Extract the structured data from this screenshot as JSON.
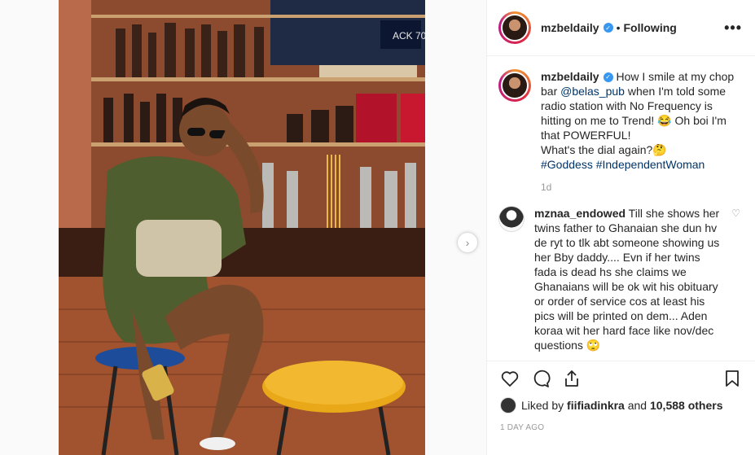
{
  "post": {
    "username": "mzbeldaily",
    "separator": "•",
    "follow_status": "Following",
    "more_label": "•••"
  },
  "caption": {
    "username": "mzbeldaily",
    "text_before_mention": "How I smile at my chop bar",
    "mention": "@belas_pub",
    "text_after_mention": "when I'm told some radio station with No Frequency is hitting on me to Trend! 😂 Oh boi I'm that POWERFUL!",
    "line2": "What's the dial again?🤔",
    "hashtag1": "#Goddess",
    "hashtag2": "#IndependentWoman",
    "time_ago": "1d"
  },
  "comment": {
    "username": "mznaa_endowed",
    "text": "Till she shows her twins father to Ghanaian she dun hv de ryt to tlk abt someone showing us her Bby daddy.... Evn if her twins fada is dead hs she claims we Ghanaians will be ok wit his obituary or order of service cos at least his pics will be printed on dem... Aden koraa wit her hard face like nov/dec questions 🙄"
  },
  "likes": {
    "prefix": "Liked by",
    "user": "fiifiadinkra",
    "connector": "and",
    "others": "10,588 others"
  },
  "date": "1 DAY AGO",
  "icons": {
    "next": "chevron-right-icon",
    "like": "heart-icon",
    "comment": "comment-icon",
    "share": "share-icon",
    "save": "bookmark-icon",
    "verified": "verified-badge-icon"
  },
  "colors": {
    "verified": "#3897f0",
    "link": "#003569",
    "muted": "#999999"
  },
  "photo_text": {
    "sign": "ACK 70"
  }
}
